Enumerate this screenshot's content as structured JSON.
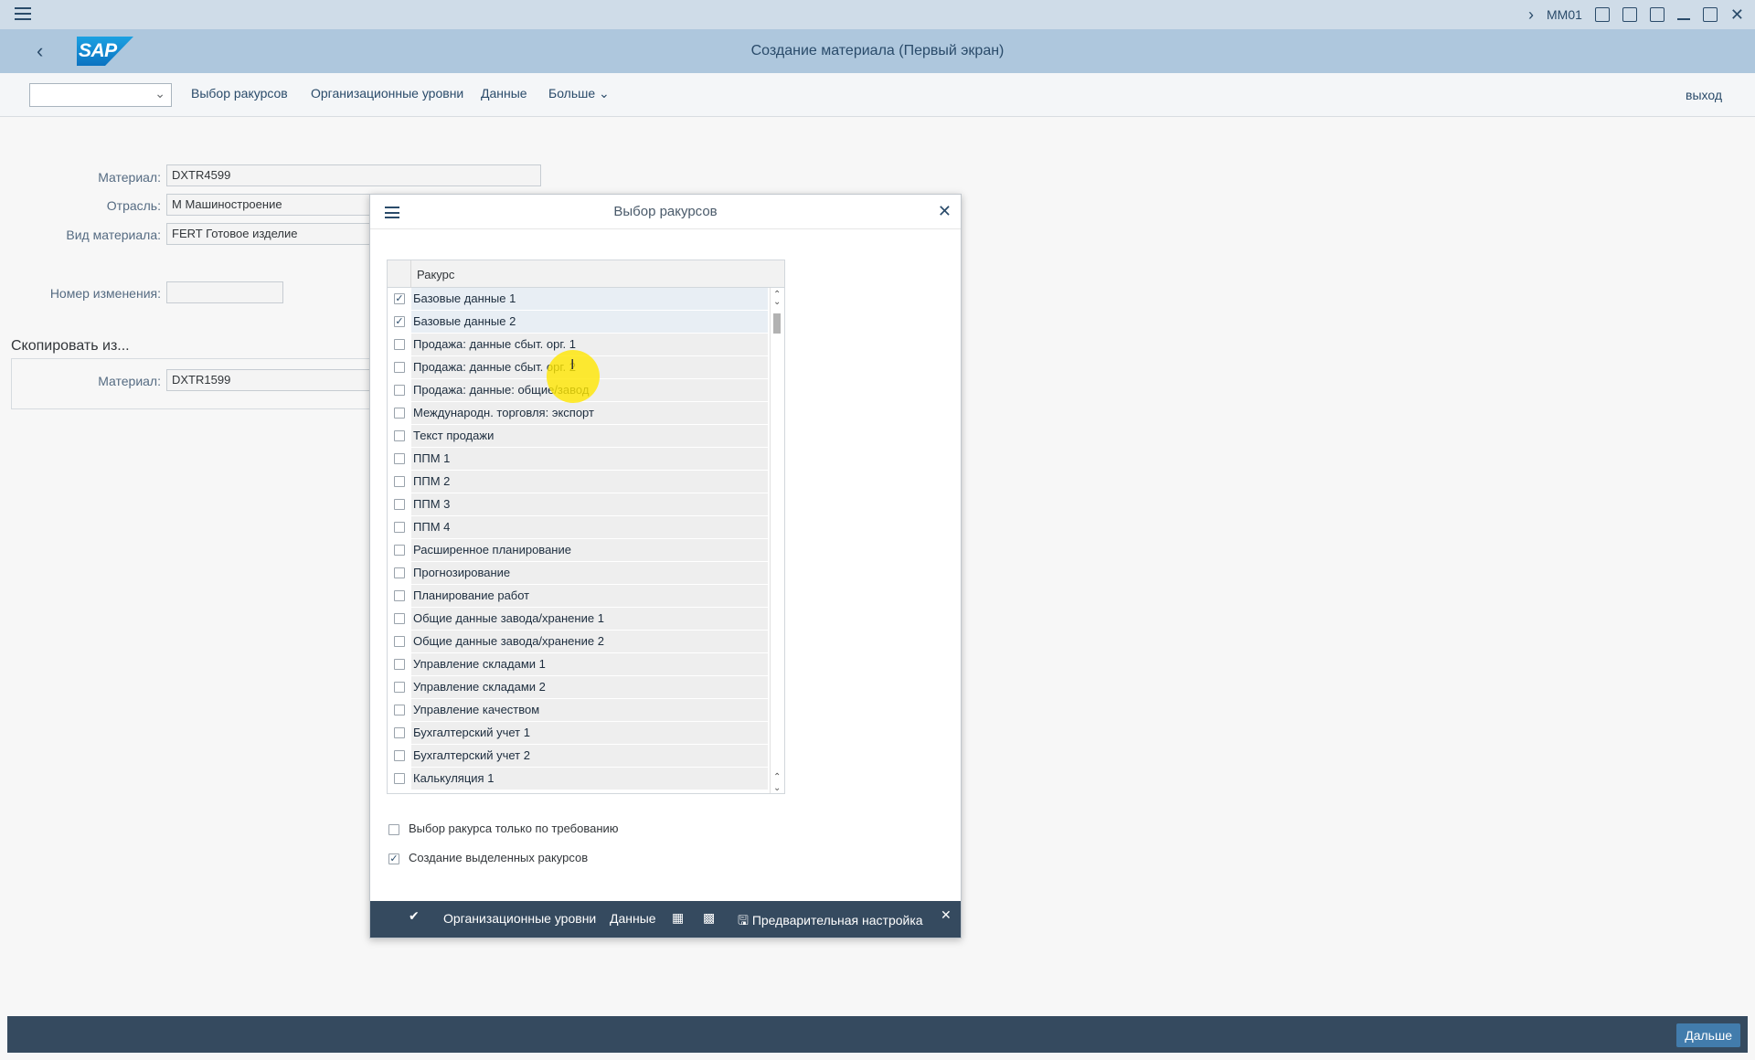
{
  "window": {
    "transaction_code": "MM01"
  },
  "shell": {
    "logo_text": "SAP",
    "title": "Создание материала (Первый экран)"
  },
  "toolbar": {
    "dropdown_value": "",
    "items": [
      "Выбор ракурсов",
      "Организационные уровни",
      "Данные",
      "Больше"
    ],
    "exit_label": "выход"
  },
  "form": {
    "material_label": "Материал:",
    "material_value": "DXTR4599",
    "industry_label": "Отрасль:",
    "industry_value": "M Машиностроение",
    "material_type_label": "Вид материала:",
    "material_type_value": "FERT Готовое изделие",
    "change_number_label": "Номер изменения:",
    "change_number_value": "",
    "copy_from_title": "Скопировать из...",
    "copy_material_label": "Материал:",
    "copy_material_value": "DXTR1599"
  },
  "dialog": {
    "title": "Выбор ракурсов",
    "column_header": "Ракурс",
    "views": [
      {
        "label": "Базовые данные 1",
        "checked": true
      },
      {
        "label": "Базовые данные 2",
        "checked": true
      },
      {
        "label": "Продажа: данные сбыт. орг. 1",
        "checked": false
      },
      {
        "label": "Продажа: данные сбыт. орг. 2",
        "checked": false
      },
      {
        "label": "Продажа: данные: общие/завод",
        "checked": false
      },
      {
        "label": "Международн. торговля: экспорт",
        "checked": false
      },
      {
        "label": "Текст продажи",
        "checked": false
      },
      {
        "label": "ППМ 1",
        "checked": false
      },
      {
        "label": "ППМ 2",
        "checked": false
      },
      {
        "label": "ППМ 3",
        "checked": false
      },
      {
        "label": "ППМ 4",
        "checked": false
      },
      {
        "label": "Расширенное планирование",
        "checked": false
      },
      {
        "label": "Прогнозирование",
        "checked": false
      },
      {
        "label": "Планирование работ",
        "checked": false
      },
      {
        "label": "Общие данные завода/хранение 1",
        "checked": false
      },
      {
        "label": "Общие данные завода/хранение 2",
        "checked": false
      },
      {
        "label": "Управление складами 1",
        "checked": false
      },
      {
        "label": "Управление складами 2",
        "checked": false
      },
      {
        "label": "Управление качеством",
        "checked": false
      },
      {
        "label": "Бухгалтерский учет 1",
        "checked": false
      },
      {
        "label": "Бухгалтерский учет 2",
        "checked": false
      },
      {
        "label": "Калькуляция 1",
        "checked": false
      }
    ],
    "option_on_demand": {
      "label": "Выбор ракурса только по требованию",
      "checked": false
    },
    "option_create_selected": {
      "label": "Создание выделенных ракурсов",
      "checked": true
    },
    "footer": {
      "org_levels": "Организационные уровни",
      "data": "Данные",
      "preset": "Предварительная настройка"
    }
  },
  "statusbar": {
    "next_button": "Дальше"
  },
  "icons": {
    "accent": "#2a4b6a",
    "footer_bg": "#354a5f",
    "ok_color": "#7ed321",
    "cancel_color": "#ff3b3b"
  }
}
